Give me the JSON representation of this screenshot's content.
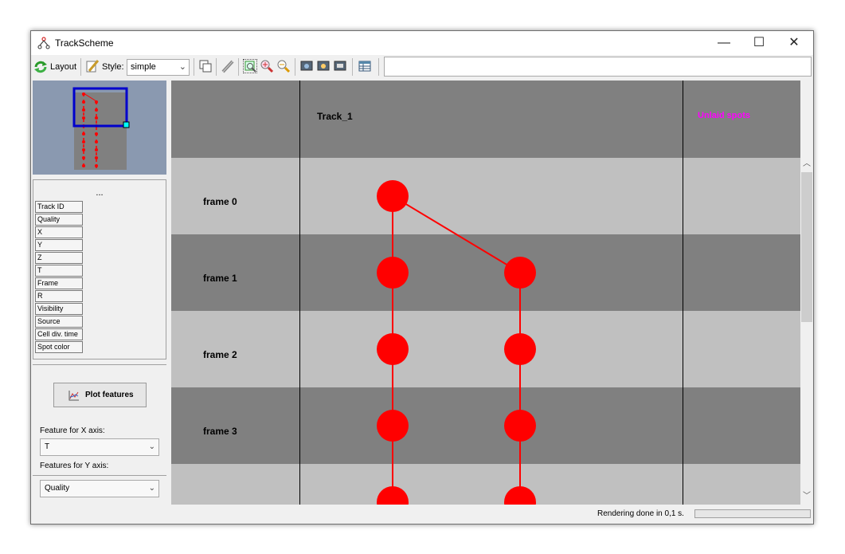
{
  "window": {
    "title": "TrackScheme",
    "minimize_glyph": "—",
    "maximize_glyph": "☐",
    "close_glyph": "✕"
  },
  "toolbar": {
    "layout_label": "Layout",
    "style_label": "Style:",
    "style_value": "simple",
    "search_value": ""
  },
  "features": {
    "header": "...",
    "items": [
      "Track ID",
      "Quality",
      "X",
      "Y",
      "Z",
      "T",
      "Frame",
      "R",
      "Visibility",
      "Source",
      "Cell div. time",
      "Spot color"
    ]
  },
  "plot": {
    "button_label": "Plot features",
    "x_axis_label": "Feature for X axis:",
    "x_axis_value": "T",
    "y_axis_label": "Features for Y axis:",
    "y_axis_value": "Quality"
  },
  "scheme": {
    "track_header": "Track_1",
    "unlaid_header": "Unlaid spots",
    "unlaid_color": "#ff00ff",
    "spot_color": "#ff0000",
    "frames": [
      "frame 0",
      "frame 1",
      "frame 2",
      "frame 3"
    ]
  },
  "status": {
    "text": "Rendering done in 0,1 s."
  },
  "colors": {
    "overview_bg": "#8a99b0",
    "viewport_rect": "#0000cc",
    "band_light": "#c0c0c0",
    "band_dark": "#808080"
  }
}
